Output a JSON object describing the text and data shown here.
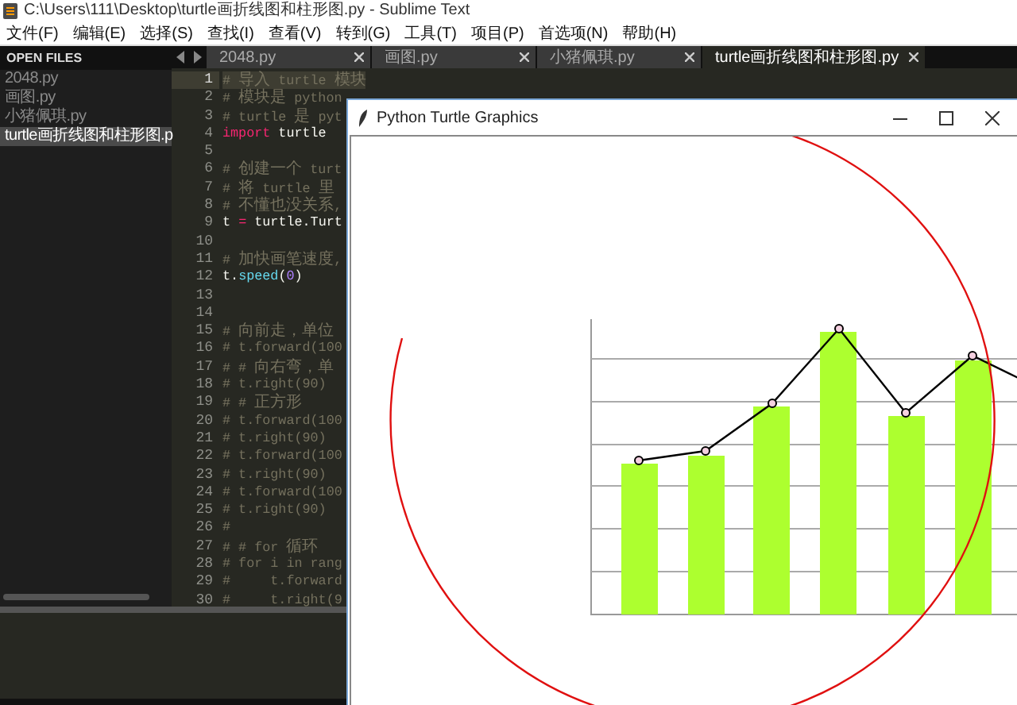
{
  "window": {
    "title": "C:\\Users\\111\\Desktop\\turtle画折线图和柱形图.py - Sublime Text"
  },
  "menu": [
    "文件(F)",
    "编辑(E)",
    "选择(S)",
    "查找(I)",
    "查看(V)",
    "转到(G)",
    "工具(T)",
    "项目(P)",
    "首选项(N)",
    "帮助(H)"
  ],
  "sidebar": {
    "header": "OPEN FILES",
    "files": [
      {
        "label": "2048.py",
        "selected": false
      },
      {
        "label": "画图.py",
        "selected": false
      },
      {
        "label": "小猪佩琪.py",
        "selected": false
      },
      {
        "label": "turtle画折线图和柱形图.p",
        "selected": true
      }
    ]
  },
  "tabs": [
    {
      "label": "2048.py",
      "selected": false
    },
    {
      "label": "画图.py",
      "selected": false
    },
    {
      "label": "小猪佩琪.py",
      "selected": false
    },
    {
      "label": "turtle画折线图和柱形图.py",
      "selected": true
    }
  ],
  "editor": {
    "lines": [
      {
        "number": "1",
        "current": true,
        "tokens": [
          {
            "kind": "comment",
            "text": "# 导入 turtle 模块"
          }
        ]
      },
      {
        "number": "2",
        "current": false,
        "tokens": [
          {
            "kind": "comment",
            "text": "# 模块是 python"
          }
        ]
      },
      {
        "number": "3",
        "current": false,
        "tokens": [
          {
            "kind": "comment",
            "text": "# turtle 是 pyt"
          }
        ]
      },
      {
        "number": "4",
        "current": false,
        "tokens": [
          {
            "kind": "keyword",
            "text": "import"
          },
          {
            "kind": "plain",
            "text": " turtle"
          }
        ]
      },
      {
        "number": "5",
        "current": false
      },
      {
        "number": "6",
        "current": false,
        "tokens": [
          {
            "kind": "comment",
            "text": "# 创建一个 turt"
          }
        ]
      },
      {
        "number": "7",
        "current": false,
        "tokens": [
          {
            "kind": "comment",
            "text": "# 将 turtle 里"
          }
        ]
      },
      {
        "number": "8",
        "current": false,
        "tokens": [
          {
            "kind": "comment",
            "text": "# 不懂也没关系,"
          }
        ]
      },
      {
        "number": "9",
        "current": false,
        "tokens": [
          {
            "kind": "plain",
            "text": "t "
          },
          {
            "kind": "keyword",
            "text": "="
          },
          {
            "kind": "plain",
            "text": " turtle.Turt"
          }
        ]
      },
      {
        "number": "10",
        "current": false
      },
      {
        "number": "11",
        "current": false,
        "tokens": [
          {
            "kind": "comment",
            "text": "# 加快画笔速度,"
          }
        ]
      },
      {
        "number": "12",
        "current": false,
        "tokens": [
          {
            "kind": "plain",
            "text": "t."
          },
          {
            "kind": "func",
            "text": "speed"
          },
          {
            "kind": "plain",
            "text": "("
          },
          {
            "kind": "number",
            "text": "0"
          },
          {
            "kind": "plain",
            "text": ")"
          }
        ]
      },
      {
        "number": "13",
        "current": false
      },
      {
        "number": "14",
        "current": false
      },
      {
        "number": "15",
        "current": false,
        "tokens": [
          {
            "kind": "comment",
            "text": "# 向前走，单位"
          }
        ]
      },
      {
        "number": "16",
        "current": false,
        "tokens": [
          {
            "kind": "comment",
            "text": "# t.forward(100"
          }
        ]
      },
      {
        "number": "17",
        "current": false,
        "tokens": [
          {
            "kind": "comment",
            "text": "# # 向右弯，单"
          }
        ]
      },
      {
        "number": "18",
        "current": false,
        "tokens": [
          {
            "kind": "comment",
            "text": "# t.right(90)"
          }
        ]
      },
      {
        "number": "19",
        "current": false,
        "tokens": [
          {
            "kind": "comment",
            "text": "# # 正方形"
          }
        ]
      },
      {
        "number": "20",
        "current": false,
        "tokens": [
          {
            "kind": "comment",
            "text": "# t.forward(100"
          }
        ]
      },
      {
        "number": "21",
        "current": false,
        "tokens": [
          {
            "kind": "comment",
            "text": "# t.right(90)"
          }
        ]
      },
      {
        "number": "22",
        "current": false,
        "tokens": [
          {
            "kind": "comment",
            "text": "# t.forward(100"
          }
        ]
      },
      {
        "number": "23",
        "current": false,
        "tokens": [
          {
            "kind": "comment",
            "text": "# t.right(90)"
          }
        ]
      },
      {
        "number": "24",
        "current": false,
        "tokens": [
          {
            "kind": "comment",
            "text": "# t.forward(100"
          }
        ]
      },
      {
        "number": "25",
        "current": false,
        "tokens": [
          {
            "kind": "comment",
            "text": "# t.right(90)"
          }
        ]
      },
      {
        "number": "26",
        "current": false,
        "tokens": [
          {
            "kind": "comment",
            "text": "#"
          }
        ]
      },
      {
        "number": "27",
        "current": false,
        "tokens": [
          {
            "kind": "comment",
            "text": "# # for 循环"
          }
        ]
      },
      {
        "number": "28",
        "current": false,
        "tokens": [
          {
            "kind": "comment",
            "text": "# for i in rang"
          }
        ]
      },
      {
        "number": "29",
        "current": false,
        "tokens": [
          {
            "kind": "comment",
            "text": "#     t.forward"
          }
        ]
      },
      {
        "number": "30",
        "current": false,
        "tokens": [
          {
            "kind": "comment",
            "text": "#     t.right(9"
          }
        ]
      }
    ]
  },
  "turtle_window": {
    "title": "Python Turtle Graphics"
  }
}
